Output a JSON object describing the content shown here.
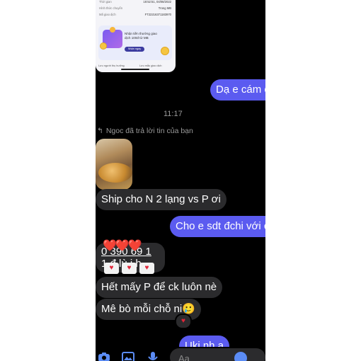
{
  "receipt": {
    "rows": [
      {
        "label": "Thời gian",
        "value": "18:52:51, 04/08/2022"
      },
      {
        "label": "Hình thức chuyển",
        "value": "Trong MB"
      },
      {
        "label": "Mã giao dịch",
        "value": "FT22216371183970"
      }
    ],
    "promo": {
      "text": "Nhận tiền thưởng giao dịch 100đ từ MB",
      "button": "Nhận ngay"
    },
    "footer": {
      "left": "Lưu người thụ hưởng",
      "right": "Lưu mẫu giao dịch"
    }
  },
  "chat": {
    "time_divider": "11:17",
    "reply_note": "Ngoc đã trả lời tin của bạn",
    "messages": {
      "out1": "Dạ e cám ơ",
      "in_ship": "Ship cho N 2 lạng vs P ơi",
      "out2": "Cho e sdt đchi với c h",
      "phone_line1": "0 390 69 1",
      "phone_line2": "1 đ  lù i  h",
      "in_het": "Hết mấy P để ck luôn nè",
      "in_mebo": "Mê bò mỗi chỗ ni🥲",
      "out3": "Uki nh     ạ"
    },
    "reactions": {
      "hearts_big": "❤️❤️❤️",
      "heart": "❤️"
    },
    "composer_placeholder": "Aa"
  },
  "icons": [
    "camera-icon",
    "photo-icon",
    "mic-icon",
    "emoji-icon",
    "reply-arrow-icon"
  ],
  "colors": {
    "outgoing": "#5b5bf0",
    "incoming": "#2b2b2d",
    "accent": "#5b8cf5"
  }
}
